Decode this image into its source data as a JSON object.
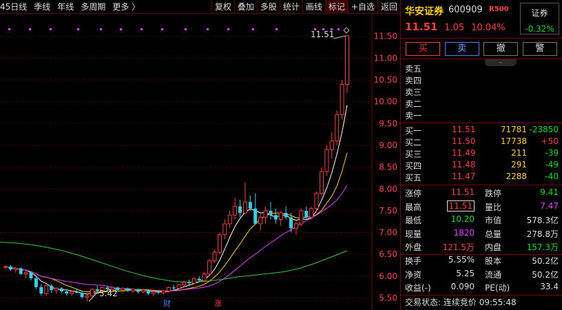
{
  "toolbar": {
    "periods": [
      "45日线",
      "季线",
      "年线",
      "多周期",
      "更多 〉"
    ],
    "buttons": [
      "复权",
      "叠加",
      "多股",
      "统计",
      "画线",
      "标记",
      "+自选",
      "返回"
    ]
  },
  "stock": {
    "name": "华安证券",
    "code": "600909",
    "tag": "R500",
    "price": "11.51",
    "change": "1.05",
    "change_pct": "10.04%",
    "index_name": "证券",
    "index_change": "-0.32%"
  },
  "trade_buttons": [
    "买",
    "卖",
    "撤",
    "警"
  ],
  "ask": {
    "labels": [
      "卖五",
      "卖四",
      "卖三",
      "卖二",
      "卖一"
    ]
  },
  "bid": {
    "rows": [
      {
        "label": "买一",
        "price": "11.51",
        "vol": "71781",
        "delta": "-23850"
      },
      {
        "label": "买二",
        "price": "11.50",
        "vol": "17738",
        "delta": "+50"
      },
      {
        "label": "买三",
        "price": "11.49",
        "vol": "211",
        "delta": "-39"
      },
      {
        "label": "买四",
        "price": "11.48",
        "vol": "291",
        "delta": "-49"
      },
      {
        "label": "买五",
        "price": "11.47",
        "vol": "2288",
        "delta": "-40"
      }
    ]
  },
  "stats1": [
    {
      "k1": "涨停",
      "v1": "11.51",
      "c1": "red",
      "k2": "跌停",
      "v2": "9.41",
      "c2": "green"
    },
    {
      "k1": "最高",
      "v1": "11.51",
      "c1": "red boxed",
      "k2": "量比",
      "v2": "7.47",
      "c2": "mag"
    },
    {
      "k1": "最低",
      "v1": "10.20",
      "c1": "green",
      "k2": "市值",
      "v2": "578.3亿",
      "c2": "white"
    },
    {
      "k1": "现量",
      "v1": "1820",
      "c1": "mag",
      "k2": "总量",
      "v2": "278.8万",
      "c2": "white"
    },
    {
      "k1": "外盘",
      "v1": "121.5万",
      "c1": "red",
      "k2": "内盘",
      "v2": "157.3万",
      "c2": "green"
    }
  ],
  "stats2": [
    {
      "k1": "换手",
      "v1": "5.55%",
      "c1": "white",
      "k2": "股本",
      "v2": "50.2亿",
      "c2": "white"
    },
    {
      "k1": "净资",
      "v1": "5.25",
      "c1": "white",
      "k2": "流通",
      "v2": "50.2亿",
      "c2": "white"
    },
    {
      "k1": "收益(-)",
      "v1": "0.090",
      "c1": "white",
      "k2": "PE(动)",
      "v2": "33.4",
      "c2": "white"
    }
  ],
  "status": {
    "label": "交易状态:",
    "value": "连续竞价 09:55:48"
  },
  "chart_data": {
    "type": "candlestick",
    "y_ticks": [
      "11.50",
      "11.00",
      "10.50",
      "10.00",
      "9.50",
      "9.00",
      "8.50",
      "8.00",
      "7.50",
      "7.00",
      "6.50",
      "6.00",
      "5.50"
    ],
    "ylim": [
      5.35,
      11.65
    ],
    "annotations": {
      "high_label": "11.51",
      "low_label": "5.42",
      "marker_cai": "财",
      "marker_zhang": "涨"
    },
    "candles": [
      [
        6.21,
        6.25,
        6.15,
        6.22
      ],
      [
        6.22,
        6.26,
        6.12,
        6.15
      ],
      [
        6.15,
        6.2,
        6.08,
        6.18
      ],
      [
        6.18,
        6.2,
        6.02,
        6.05
      ],
      [
        6.05,
        6.12,
        5.95,
        6.08
      ],
      [
        6.08,
        6.1,
        5.9,
        5.95
      ],
      [
        5.95,
        6.02,
        5.7,
        5.75
      ],
      [
        5.75,
        5.82,
        5.55,
        5.6
      ],
      [
        5.6,
        5.8,
        5.55,
        5.78
      ],
      [
        5.78,
        5.82,
        5.62,
        5.68
      ],
      [
        5.68,
        5.75,
        5.6,
        5.72
      ],
      [
        5.72,
        5.75,
        5.62,
        5.65
      ],
      [
        5.65,
        5.7,
        5.55,
        5.6
      ],
      [
        5.6,
        5.68,
        5.55,
        5.65
      ],
      [
        5.65,
        5.72,
        5.6,
        5.62
      ],
      [
        5.62,
        5.66,
        5.48,
        5.52
      ],
      [
        5.52,
        5.58,
        5.42,
        5.55
      ],
      [
        5.55,
        5.72,
        5.52,
        5.7
      ],
      [
        5.7,
        5.78,
        5.62,
        5.66
      ],
      [
        5.66,
        5.76,
        5.64,
        5.74
      ],
      [
        5.74,
        5.78,
        5.66,
        5.7
      ],
      [
        5.7,
        5.76,
        5.66,
        5.74
      ],
      [
        5.74,
        5.76,
        5.66,
        5.68
      ],
      [
        5.68,
        5.74,
        5.64,
        5.72
      ],
      [
        5.72,
        5.74,
        5.64,
        5.66
      ],
      [
        5.66,
        5.72,
        5.62,
        5.7
      ],
      [
        5.7,
        5.72,
        5.6,
        5.64
      ],
      [
        5.64,
        5.7,
        5.6,
        5.68
      ],
      [
        5.68,
        5.7,
        5.56,
        5.6
      ],
      [
        5.6,
        5.66,
        5.54,
        5.64
      ],
      [
        5.64,
        5.68,
        5.58,
        5.62
      ],
      [
        5.62,
        5.68,
        5.58,
        5.66
      ],
      [
        5.66,
        5.76,
        5.62,
        5.74
      ],
      [
        5.74,
        5.8,
        5.68,
        5.72
      ],
      [
        5.72,
        5.82,
        5.7,
        5.8
      ],
      [
        5.8,
        5.9,
        5.76,
        5.86
      ],
      [
        5.86,
        5.92,
        5.8,
        5.84
      ],
      [
        5.84,
        5.98,
        5.82,
        5.94
      ],
      [
        5.94,
        6.0,
        5.86,
        5.9
      ],
      [
        5.9,
        6.1,
        5.85,
        6.05
      ],
      [
        6.05,
        6.4,
        6.0,
        6.35
      ],
      [
        6.35,
        6.6,
        6.3,
        6.55
      ],
      [
        6.55,
        7.0,
        6.5,
        6.95
      ],
      [
        6.95,
        7.3,
        6.85,
        7.2
      ],
      [
        7.2,
        7.5,
        7.1,
        7.4
      ],
      [
        7.4,
        7.8,
        7.3,
        7.6
      ],
      [
        7.6,
        7.75,
        7.35,
        7.45
      ],
      [
        7.45,
        8.15,
        7.4,
        7.7
      ],
      [
        7.7,
        7.85,
        7.5,
        7.55
      ],
      [
        7.55,
        7.9,
        7.45,
        7.2
      ],
      [
        7.2,
        7.45,
        7.05,
        7.35
      ],
      [
        7.35,
        7.6,
        7.2,
        7.5
      ],
      [
        7.5,
        7.7,
        7.3,
        7.4
      ],
      [
        7.4,
        7.55,
        7.2,
        7.3
      ],
      [
        7.3,
        7.5,
        7.15,
        7.45
      ],
      [
        7.45,
        7.6,
        7.3,
        7.35
      ],
      [
        7.35,
        7.45,
        7.0,
        7.1
      ],
      [
        7.1,
        7.3,
        6.95,
        7.2
      ],
      [
        7.2,
        7.55,
        7.15,
        7.5
      ],
      [
        7.5,
        7.6,
        7.3,
        7.35
      ],
      [
        7.35,
        7.6,
        7.3,
        7.55
      ],
      [
        7.55,
        7.95,
        7.5,
        7.9
      ],
      [
        7.9,
        8.5,
        7.85,
        8.4
      ],
      [
        8.4,
        9.0,
        8.3,
        8.9
      ],
      [
        8.9,
        9.3,
        8.7,
        9.1
      ],
      [
        9.1,
        9.8,
        9.0,
        9.7
      ],
      [
        9.7,
        10.5,
        9.6,
        10.4
      ],
      [
        10.4,
        11.51,
        10.2,
        11.51
      ]
    ]
  }
}
